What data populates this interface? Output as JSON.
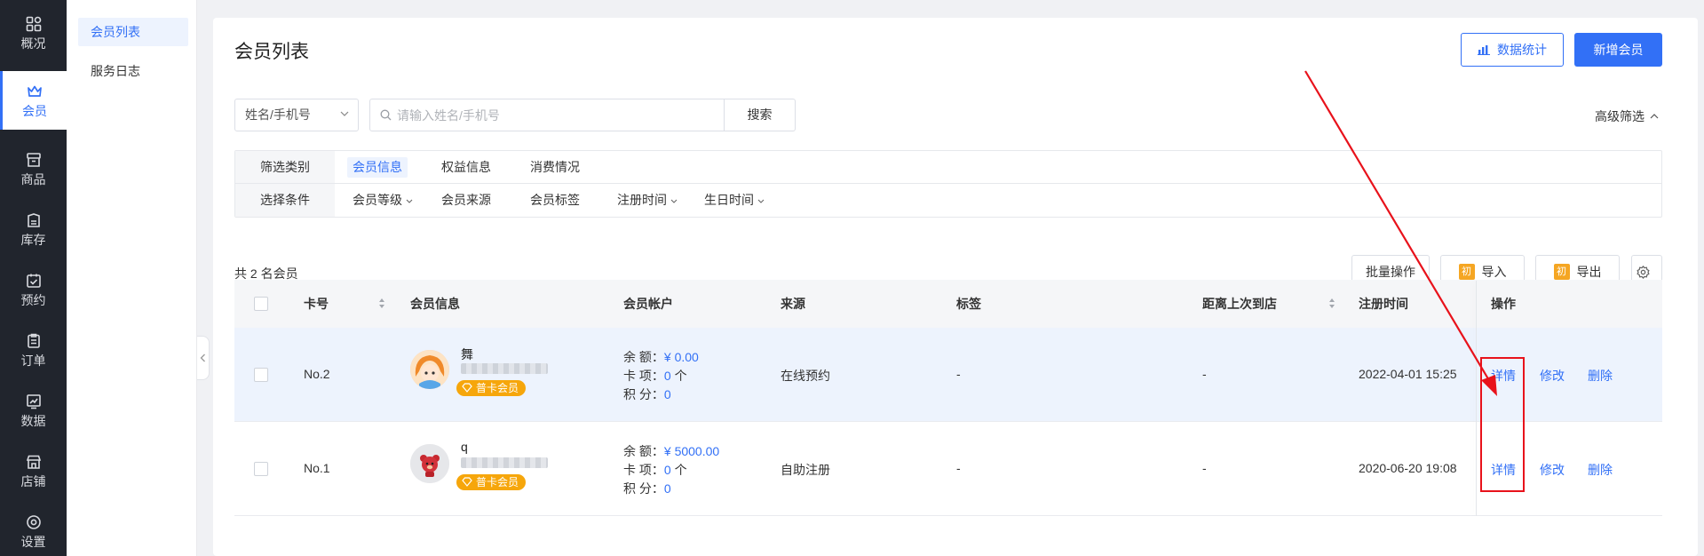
{
  "rail": {
    "items": [
      {
        "label": "概况",
        "icon": "grid-icon"
      },
      {
        "label": "会员",
        "icon": "crown-icon"
      },
      {
        "label": "商品",
        "icon": "box-icon"
      },
      {
        "label": "库存",
        "icon": "inventory-icon"
      },
      {
        "label": "预约",
        "icon": "calendar-check-icon"
      },
      {
        "label": "订单",
        "icon": "order-icon"
      },
      {
        "label": "数据",
        "icon": "chart-icon"
      },
      {
        "label": "店铺",
        "icon": "store-icon"
      },
      {
        "label": "设置",
        "icon": "gear-icon"
      }
    ],
    "active": "会员"
  },
  "subnav": {
    "items": [
      {
        "label": "会员列表"
      },
      {
        "label": "服务日志"
      }
    ],
    "active": "会员列表"
  },
  "header": {
    "title": "会员列表",
    "stats_button": "数据统计",
    "add_button": "新增会员"
  },
  "search": {
    "field_select": "姓名/手机号",
    "placeholder": "请输入姓名/手机号",
    "button": "搜索",
    "advanced": "高级筛选"
  },
  "filters": {
    "category_key": "筛选类别",
    "categories": [
      "会员信息",
      "权益信息",
      "消费情况"
    ],
    "active_category": "会员信息",
    "condition_key": "选择条件",
    "conditions": [
      "会员等级",
      "会员来源",
      "会员标签",
      "注册时间",
      "生日时间"
    ]
  },
  "toolbar": {
    "total": "共 2 名会员",
    "batch": "批量操作",
    "import": "导入",
    "export": "导出",
    "init_badge": "初"
  },
  "table": {
    "headers": {
      "card_no": "卡号",
      "member_info": "会员信息",
      "account": "会员帐户",
      "source": "来源",
      "tags": "标签",
      "last_visit": "距离上次到店",
      "reg_time": "注册时间",
      "ops": "操作"
    },
    "account_labels": {
      "balance": "余 额：",
      "cards": "卡 项：",
      "points": "积 分："
    },
    "rows": [
      {
        "card_no": "No.2",
        "name": "舞",
        "tag": "普卡会员",
        "balance": "¥ 0.00",
        "cards": "0",
        "cards_unit": " 个",
        "points": "0",
        "source": "在线预约",
        "tags": "-",
        "last_visit": "-",
        "reg_time": "2022-04-01 15:25",
        "ops": [
          "详情",
          "修改",
          "删除"
        ]
      },
      {
        "card_no": "No.1",
        "name": "q",
        "tag": "普卡会员",
        "balance": "¥ 5000.00",
        "cards": "0",
        "cards_unit": " 个",
        "points": "0",
        "source": "自助注册",
        "tags": "-",
        "last_visit": "-",
        "reg_time": "2020-06-20 19:08",
        "ops": [
          "详情",
          "修改",
          "删除"
        ]
      }
    ]
  },
  "colors": {
    "primary": "#3270f6",
    "rail_bg": "#21252d",
    "vip": "#f6a60b",
    "annotation": "#e8121b"
  }
}
